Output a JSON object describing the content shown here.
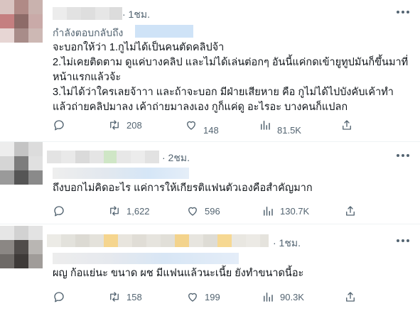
{
  "tweets": [
    {
      "time": "· 1ชม.",
      "replying_label": "กำลังตอบกลับถึง",
      "text": "จะบอกให้ว่า 1.กูไม่ได้เป็นคนตัดคลิปจ้า\n2.ไม่เคยติดตาม ดูแค่บางคลิป และไม่ได้เล่นต่อกๆ อันนี้แค่กดเข้ายูทูปมันก็ขึ้นมาที่หน้าแรกแล้วจ้ะ\n3.ไม่ได้ว่าใครเลยจ้าาา และถ้าจะบอก มีฝ่ายเสียหาย คือ กูไม่ได้ไปบังคับเค้าทำแล้วถ่ายคลิปมาลง เค้าถ่ายมาลงเอง กูก็แค่ดู อะไรอะ บางคนก็แปลก",
      "reply_count": "",
      "retweet_count": "208",
      "like_count": "148",
      "view_count": "81.5K"
    },
    {
      "time": "· 2ชม.",
      "text": "ถึงบอกไม่คิดอะไร แค่การให้เกียรติแฟนตัวเองคือสำคัญมาก",
      "reply_count": "",
      "retweet_count": "1,622",
      "like_count": "596",
      "view_count": "130.7K"
    },
    {
      "time": "· 1ชม.",
      "text": "ผญ ก้อแย่นะ ขนาด ผช มีแฟนแล้วนะเนี้ย ยังทำขนาดนี้อะ",
      "reply_count": "",
      "retweet_count": "158",
      "like_count": "199",
      "view_count": "90.3K"
    }
  ],
  "icons": {
    "reply": "reply-icon",
    "retweet": "retweet-icon",
    "like": "heart-icon",
    "views": "views-icon",
    "share": "share-icon",
    "more": "more-icon"
  },
  "colors": {
    "text": "#0f1419",
    "secondary": "#536471",
    "border": "#eff3f4",
    "mention_blur": "#cfe3f7"
  }
}
